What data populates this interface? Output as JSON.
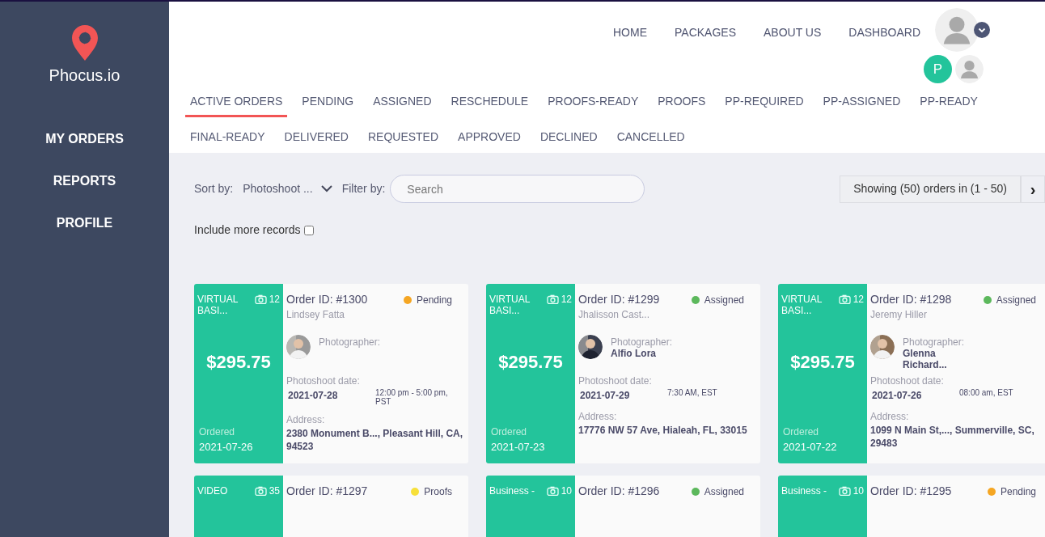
{
  "brand": {
    "name": "Phocus.io"
  },
  "sidebar": {
    "items": [
      {
        "label": "MY ORDERS"
      },
      {
        "label": "REPORTS"
      },
      {
        "label": "PROFILE"
      }
    ]
  },
  "nav": {
    "links": [
      "HOME",
      "PACKAGES",
      "ABOUT US",
      "DASHBOARD"
    ],
    "user_initial": "P"
  },
  "tabs": [
    {
      "label": "ACTIVE ORDERS",
      "selected": true
    },
    {
      "label": "PENDING",
      "selected": false
    },
    {
      "label": "ASSIGNED",
      "selected": false
    },
    {
      "label": "RESCHEDULE",
      "selected": false
    },
    {
      "label": "PROOFS-READY",
      "selected": false
    },
    {
      "label": "PROOFS",
      "selected": false
    },
    {
      "label": "PP-REQUIRED",
      "selected": false
    },
    {
      "label": "PP-ASSIGNED",
      "selected": false
    },
    {
      "label": "PP-READY",
      "selected": false
    },
    {
      "label": "FINAL-READY",
      "selected": false
    },
    {
      "label": "DELIVERED",
      "selected": false
    },
    {
      "label": "REQUESTED",
      "selected": false
    },
    {
      "label": "APPROVED",
      "selected": false
    },
    {
      "label": "DECLINED",
      "selected": false
    },
    {
      "label": "CANCELLED",
      "selected": false
    }
  ],
  "toolbar": {
    "sort_label": "Sort by:",
    "sort_value": "Photoshoot ...",
    "filter_label": "Filter by:",
    "search_placeholder": "Search",
    "showing": "Showing (50) orders in (1 - 50)",
    "next": "›",
    "include_label": "Include more records",
    "include_checked": false
  },
  "orders": [
    {
      "package": "VIRTUAL BASI...",
      "photos": "12",
      "price": "$295.75",
      "ordered_label": "Ordered",
      "ordered": "2021-07-26",
      "order_id": "Order ID: #1300",
      "customer": "Lindsey Fatta",
      "status": "Pending",
      "color": "#f5a623",
      "photographer_label": "Photographer:",
      "shoot_label": "Photoshoot date:",
      "shoot_date": "2021-07-28",
      "shoot_time": "12:00 pm - 5:00 pm, PST",
      "address_label": "Address:",
      "address": "2380 Monument B..., Pleasant Hill, CA, 94523"
    },
    {
      "package": "VIRTUAL BASI...",
      "photos": "12",
      "price": "$295.75",
      "ordered_label": "Ordered",
      "ordered": "2021-07-23",
      "order_id": "Order ID: #1299",
      "customer": "Jhalisson Cast...",
      "status": "Assigned",
      "color": "#5cb85c",
      "photographer_label": "Photographer:",
      "photographer": "Alfio Lora",
      "shoot_label": "Photoshoot date:",
      "shoot_date": "2021-07-29",
      "shoot_time": "7:30 AM, EST",
      "address_label": "Address:",
      "address": "17776 NW 57 Ave, Hialeah, FL, 33015"
    },
    {
      "package": "VIRTUAL BASI...",
      "photos": "12",
      "price": "$295.75",
      "ordered_label": "Ordered",
      "ordered": "2021-07-22",
      "order_id": "Order ID: #1298",
      "customer": "Jeremy Hiller",
      "status": "Assigned",
      "color": "#5cb85c",
      "photographer_label": "Photographer:",
      "photographer": "Glenna Richard...",
      "shoot_label": "Photoshoot date:",
      "shoot_date": "2021-07-26",
      "shoot_time": "08:00 am, EST",
      "address_label": "Address:",
      "address": "1099 N Main St,..., Summerville, SC, 29483"
    },
    {
      "package": "VIDEO",
      "photos": "35",
      "order_id": "Order ID: #1297",
      "status": "Proofs",
      "color": "#f7e03a"
    },
    {
      "package": "Business -",
      "photos": "10",
      "order_id": "Order ID: #1296",
      "status": "Assigned",
      "color": "#5cb85c"
    },
    {
      "package": "Business -",
      "photos": "10",
      "order_id": "Order ID: #1295",
      "status": "Pending",
      "color": "#f5a623"
    }
  ]
}
